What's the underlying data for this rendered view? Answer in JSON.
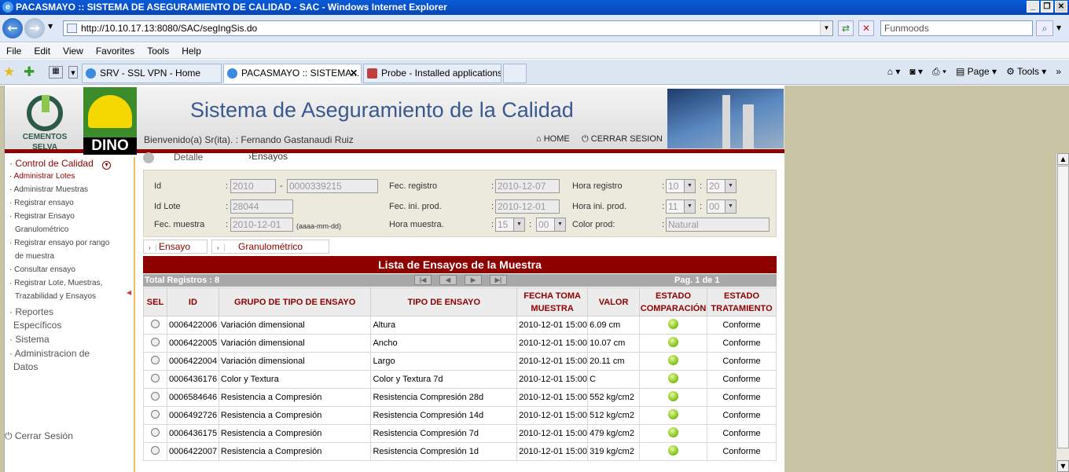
{
  "window": {
    "title": "PACASMAYO :: SISTEMA DE ASEGURAMIENTO DE CALIDAD - SAC - Windows Internet Explorer"
  },
  "address": {
    "url": "http://10.10.17.13:8080/SAC/segIngSis.do",
    "search_placeholder": "Funmoods"
  },
  "menu": [
    "File",
    "Edit",
    "View",
    "Favorites",
    "Tools",
    "Help"
  ],
  "tabs": [
    {
      "label": "SRV - SSL VPN - Home"
    },
    {
      "label": "PACASMAYO :: SISTEMA..."
    },
    {
      "label": "Probe - Installed applications"
    }
  ],
  "commandbar": {
    "page": "Page",
    "tools": "Tools"
  },
  "header": {
    "logo1_line1": "CEMENTOS",
    "logo1_line2": "SELVA",
    "logo2": "DINO",
    "title": "Sistema de Aseguramiento de la Calidad",
    "welcome": "Bienvenido(a) Sr(ita). : Fernando Gastanaudi Ruiz",
    "home": "HOME",
    "logout": "CERRAR SESION"
  },
  "sidebar": {
    "control": "Control de Calidad",
    "items": [
      "Administrar Lotes",
      "Administrar Muestras",
      "Registrar ensayo",
      "Registrar Ensayo",
      "Granulométrico",
      "Registrar ensayo por rango",
      "de muestra",
      "Consultar ensayo",
      "Registrar Lote, Muestras,",
      "Trazabilidad y Ensayos"
    ],
    "reportes1": "Reportes",
    "reportes2": "Específicos",
    "sistema": "Sistema",
    "admin1": "Administracion de",
    "admin2": "Datos",
    "cerrar": "Cerrar Sesión"
  },
  "subtabs": {
    "detalle": "Detalle",
    "ensayos": "Ensayos"
  },
  "form": {
    "id_label": "Id",
    "id_year": "2010",
    "id_num": "0000339215",
    "idlote_label": "Id Lote",
    "idlote": "28044",
    "fecmuestra_label": "Fec. muestra",
    "fecmuestra": "2010-12-01",
    "fecmuestra_hint": "(aaaa-mm-dd)",
    "fecreg_label": "Fec. registro",
    "fecreg": "2010-12-07",
    "fecini_label": "Fec. ini. prod.",
    "fecini": "2010-12-01",
    "horamuestra_label": "Hora muestra.",
    "horamuestra_h": "15",
    "horamuestra_m": "00",
    "horareg_label": "Hora registro",
    "horareg_h": "10",
    "horareg_m": "20",
    "horaini_label": "Hora ini. prod.",
    "horaini_h": "11",
    "horaini_m": "00",
    "color_label": "Color prod:",
    "color": "Natural"
  },
  "bottomtabs": {
    "ensayo": "Ensayo",
    "granulo": "Granulométrico"
  },
  "list": {
    "title": "Lista de Ensayos de la Muestra",
    "total": "Total Registros : 8",
    "page": "Pag. 1 de 1",
    "headers": {
      "sel": "SEL",
      "id": "ID",
      "grupo": "GRUPO DE TIPO DE ENSAYO",
      "tipo": "TIPO DE ENSAYO",
      "fecha1": "FECHA TOMA",
      "fecha2": "MUESTRA",
      "valor": "VALOR",
      "comp1": "ESTADO",
      "comp2": "COMPARACIÓN",
      "trat1": "ESTADO",
      "trat2": "TRATAMIENTO"
    },
    "rows": [
      {
        "id": "0006422006",
        "grupo": "Variación dimensional",
        "tipo": "Altura",
        "fecha": "2010-12-01 15:00",
        "valor": "6.09 cm",
        "estado": "Conforme"
      },
      {
        "id": "0006422005",
        "grupo": "Variación dimensional",
        "tipo": "Ancho",
        "fecha": "2010-12-01 15:00",
        "valor": "10.07 cm",
        "estado": "Conforme"
      },
      {
        "id": "0006422004",
        "grupo": "Variación dimensional",
        "tipo": "Largo",
        "fecha": "2010-12-01 15:00",
        "valor": "20.11 cm",
        "estado": "Conforme"
      },
      {
        "id": "0006436176",
        "grupo": "Color y Textura",
        "tipo": "Color y Textura 7d",
        "fecha": "2010-12-01 15:00",
        "valor": "C",
        "estado": "Conforme"
      },
      {
        "id": "0006584646",
        "grupo": "Resistencia a Compresión",
        "tipo": "Resistencia Compresión 28d",
        "fecha": "2010-12-01 15:00",
        "valor": "552 kg/cm2",
        "estado": "Conforme"
      },
      {
        "id": "0006492726",
        "grupo": "Resistencia a Compresión",
        "tipo": "Resistencia Compresión 14d",
        "fecha": "2010-12-01 15:00",
        "valor": "512 kg/cm2",
        "estado": "Conforme"
      },
      {
        "id": "0006436175",
        "grupo": "Resistencia a Compresión",
        "tipo": "Resistencia Compresión 7d",
        "fecha": "2010-12-01 15:00",
        "valor": "479 kg/cm2",
        "estado": "Conforme"
      },
      {
        "id": "0006422007",
        "grupo": "Resistencia a Compresión",
        "tipo": "Resistencia Compresión 1d",
        "fecha": "2010-12-01 15:00",
        "valor": "319 kg/cm2",
        "estado": "Conforme"
      }
    ]
  }
}
